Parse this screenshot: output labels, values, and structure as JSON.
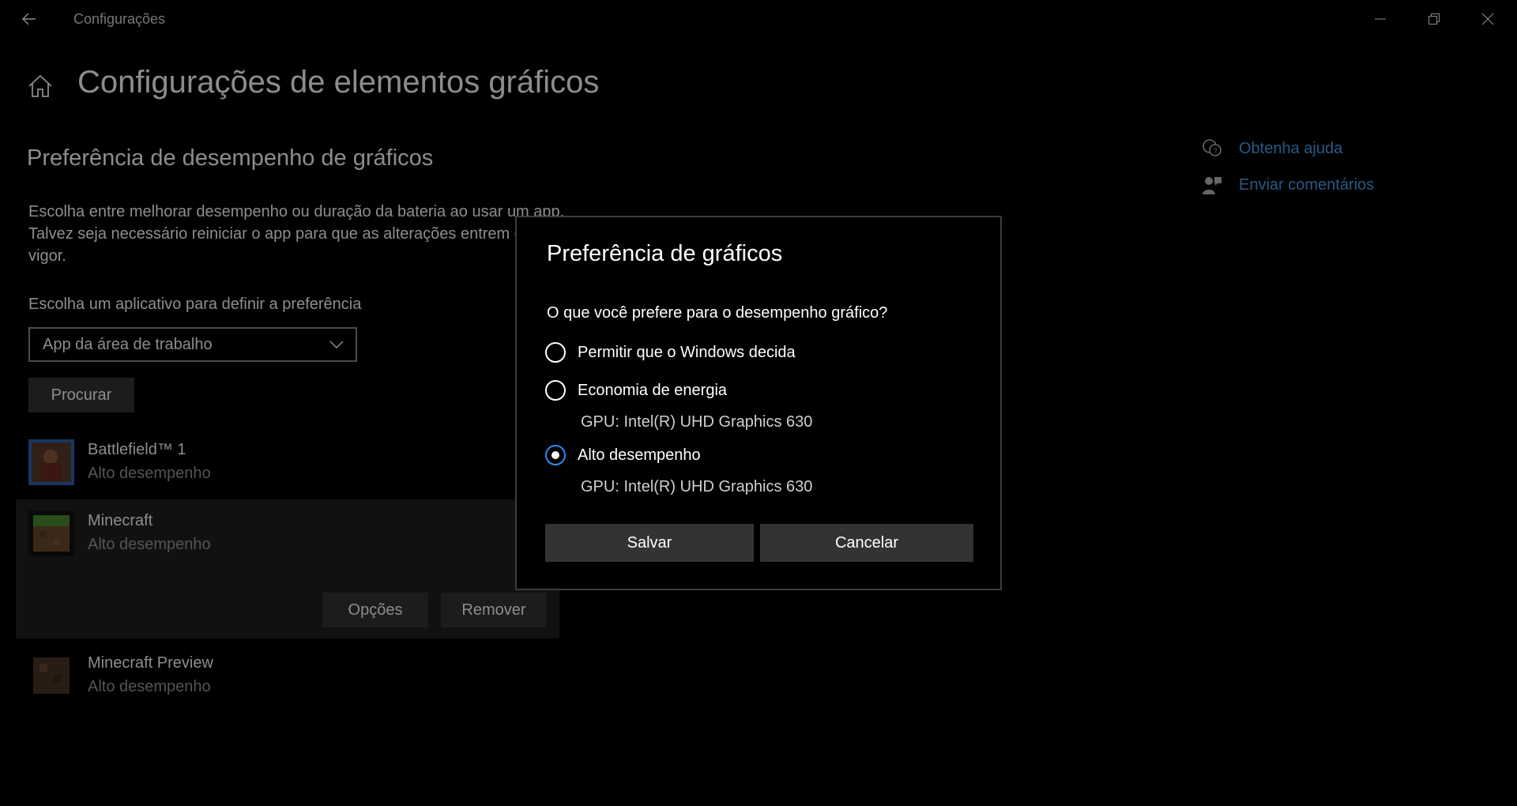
{
  "window": {
    "title": "Configurações",
    "back_icon": "arrow-left-icon",
    "minimize_icon": "minimize-icon",
    "restore_icon": "restore-icon",
    "close_icon": "close-icon"
  },
  "header": {
    "home_icon": "home-icon",
    "title": "Configurações de elementos gráficos"
  },
  "section": {
    "title": "Preferência de desempenho de gráficos",
    "description": "Escolha entre melhorar desempenho ou duração da bateria ao usar um app. Talvez seja necessário reiniciar o app para que as alterações entrem em vigor.",
    "choose_label": "Escolha um aplicativo para definir a preferência",
    "dropdown_value": "App da área de trabalho",
    "browse_button": "Procurar"
  },
  "apps": [
    {
      "name": "Battlefield™ 1",
      "preference": "Alto desempenho",
      "icon": "battlefield-icon"
    },
    {
      "name": "Minecraft",
      "preference": "Alto desempenho",
      "icon": "minecraft-icon",
      "selected": true
    },
    {
      "name": "Minecraft Preview",
      "preference": "Alto desempenho",
      "icon": "minecraft-preview-icon"
    }
  ],
  "app_actions": {
    "options": "Opções",
    "remove": "Remover"
  },
  "side_links": [
    {
      "label": "Obtenha ajuda",
      "icon": "help-chat-icon"
    },
    {
      "label": "Enviar comentários",
      "icon": "feedback-icon"
    }
  ],
  "dialog": {
    "title": "Preferência de gráficos",
    "question": "O que você prefere para o desempenho gráfico?",
    "options": [
      {
        "label": "Permitir que o Windows decida",
        "gpu": "",
        "checked": false
      },
      {
        "label": "Economia de energia",
        "gpu": "GPU: Intel(R) UHD Graphics 630",
        "checked": false
      },
      {
        "label": "Alto desempenho",
        "gpu": "GPU: Intel(R) UHD Graphics 630",
        "checked": true
      }
    ],
    "save": "Salvar",
    "cancel": "Cancelar"
  },
  "colors": {
    "background": "#000000",
    "accent": "#2a8af6",
    "link": "#4aa0ee",
    "button": "#333333"
  }
}
